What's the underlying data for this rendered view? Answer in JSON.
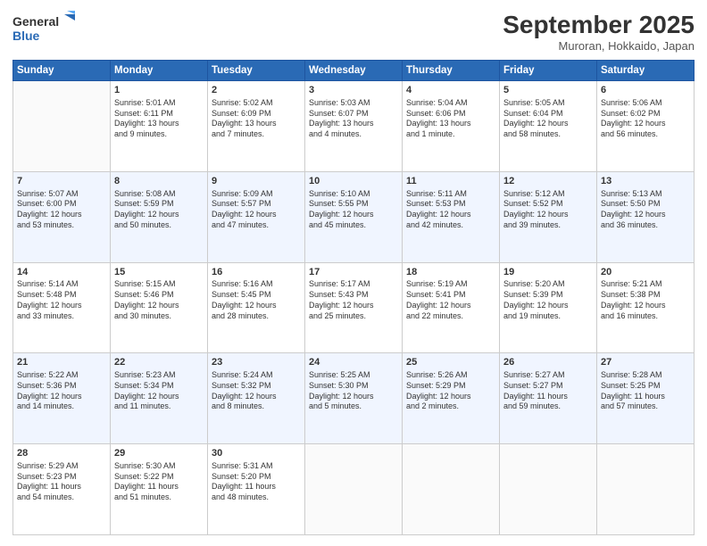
{
  "header": {
    "logo_line1": "General",
    "logo_line2": "Blue",
    "month_title": "September 2025",
    "location": "Muroran, Hokkaido, Japan"
  },
  "weekdays": [
    "Sunday",
    "Monday",
    "Tuesday",
    "Wednesday",
    "Thursday",
    "Friday",
    "Saturday"
  ],
  "weeks": [
    [
      {
        "day": "",
        "info": ""
      },
      {
        "day": "1",
        "info": "Sunrise: 5:01 AM\nSunset: 6:11 PM\nDaylight: 13 hours\nand 9 minutes."
      },
      {
        "day": "2",
        "info": "Sunrise: 5:02 AM\nSunset: 6:09 PM\nDaylight: 13 hours\nand 7 minutes."
      },
      {
        "day": "3",
        "info": "Sunrise: 5:03 AM\nSunset: 6:07 PM\nDaylight: 13 hours\nand 4 minutes."
      },
      {
        "day": "4",
        "info": "Sunrise: 5:04 AM\nSunset: 6:06 PM\nDaylight: 13 hours\nand 1 minute."
      },
      {
        "day": "5",
        "info": "Sunrise: 5:05 AM\nSunset: 6:04 PM\nDaylight: 12 hours\nand 58 minutes."
      },
      {
        "day": "6",
        "info": "Sunrise: 5:06 AM\nSunset: 6:02 PM\nDaylight: 12 hours\nand 56 minutes."
      }
    ],
    [
      {
        "day": "7",
        "info": "Sunrise: 5:07 AM\nSunset: 6:00 PM\nDaylight: 12 hours\nand 53 minutes."
      },
      {
        "day": "8",
        "info": "Sunrise: 5:08 AM\nSunset: 5:59 PM\nDaylight: 12 hours\nand 50 minutes."
      },
      {
        "day": "9",
        "info": "Sunrise: 5:09 AM\nSunset: 5:57 PM\nDaylight: 12 hours\nand 47 minutes."
      },
      {
        "day": "10",
        "info": "Sunrise: 5:10 AM\nSunset: 5:55 PM\nDaylight: 12 hours\nand 45 minutes."
      },
      {
        "day": "11",
        "info": "Sunrise: 5:11 AM\nSunset: 5:53 PM\nDaylight: 12 hours\nand 42 minutes."
      },
      {
        "day": "12",
        "info": "Sunrise: 5:12 AM\nSunset: 5:52 PM\nDaylight: 12 hours\nand 39 minutes."
      },
      {
        "day": "13",
        "info": "Sunrise: 5:13 AM\nSunset: 5:50 PM\nDaylight: 12 hours\nand 36 minutes."
      }
    ],
    [
      {
        "day": "14",
        "info": "Sunrise: 5:14 AM\nSunset: 5:48 PM\nDaylight: 12 hours\nand 33 minutes."
      },
      {
        "day": "15",
        "info": "Sunrise: 5:15 AM\nSunset: 5:46 PM\nDaylight: 12 hours\nand 30 minutes."
      },
      {
        "day": "16",
        "info": "Sunrise: 5:16 AM\nSunset: 5:45 PM\nDaylight: 12 hours\nand 28 minutes."
      },
      {
        "day": "17",
        "info": "Sunrise: 5:17 AM\nSunset: 5:43 PM\nDaylight: 12 hours\nand 25 minutes."
      },
      {
        "day": "18",
        "info": "Sunrise: 5:19 AM\nSunset: 5:41 PM\nDaylight: 12 hours\nand 22 minutes."
      },
      {
        "day": "19",
        "info": "Sunrise: 5:20 AM\nSunset: 5:39 PM\nDaylight: 12 hours\nand 19 minutes."
      },
      {
        "day": "20",
        "info": "Sunrise: 5:21 AM\nSunset: 5:38 PM\nDaylight: 12 hours\nand 16 minutes."
      }
    ],
    [
      {
        "day": "21",
        "info": "Sunrise: 5:22 AM\nSunset: 5:36 PM\nDaylight: 12 hours\nand 14 minutes."
      },
      {
        "day": "22",
        "info": "Sunrise: 5:23 AM\nSunset: 5:34 PM\nDaylight: 12 hours\nand 11 minutes."
      },
      {
        "day": "23",
        "info": "Sunrise: 5:24 AM\nSunset: 5:32 PM\nDaylight: 12 hours\nand 8 minutes."
      },
      {
        "day": "24",
        "info": "Sunrise: 5:25 AM\nSunset: 5:30 PM\nDaylight: 12 hours\nand 5 minutes."
      },
      {
        "day": "25",
        "info": "Sunrise: 5:26 AM\nSunset: 5:29 PM\nDaylight: 12 hours\nand 2 minutes."
      },
      {
        "day": "26",
        "info": "Sunrise: 5:27 AM\nSunset: 5:27 PM\nDaylight: 11 hours\nand 59 minutes."
      },
      {
        "day": "27",
        "info": "Sunrise: 5:28 AM\nSunset: 5:25 PM\nDaylight: 11 hours\nand 57 minutes."
      }
    ],
    [
      {
        "day": "28",
        "info": "Sunrise: 5:29 AM\nSunset: 5:23 PM\nDaylight: 11 hours\nand 54 minutes."
      },
      {
        "day": "29",
        "info": "Sunrise: 5:30 AM\nSunset: 5:22 PM\nDaylight: 11 hours\nand 51 minutes."
      },
      {
        "day": "30",
        "info": "Sunrise: 5:31 AM\nSunset: 5:20 PM\nDaylight: 11 hours\nand 48 minutes."
      },
      {
        "day": "",
        "info": ""
      },
      {
        "day": "",
        "info": ""
      },
      {
        "day": "",
        "info": ""
      },
      {
        "day": "",
        "info": ""
      }
    ]
  ]
}
